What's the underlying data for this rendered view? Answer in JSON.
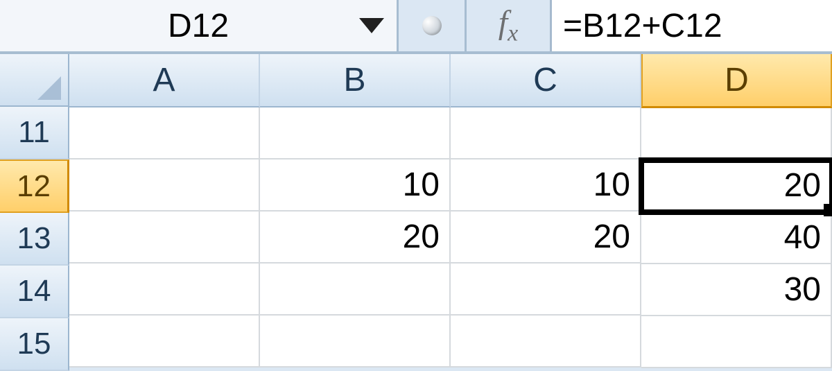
{
  "formula_bar": {
    "name_box": "D12",
    "fx_label": "fx",
    "formula": "=B12+C12"
  },
  "columns": [
    "A",
    "B",
    "C",
    "D"
  ],
  "rows": [
    "11",
    "12",
    "13",
    "14",
    "15"
  ],
  "selected_cell": "D12",
  "cells": {
    "A": {
      "11": "",
      "12": "",
      "13": "",
      "14": "",
      "15": ""
    },
    "B": {
      "11": "",
      "12": "10",
      "13": "20",
      "14": "",
      "15": ""
    },
    "C": {
      "11": "",
      "12": "10",
      "13": "20",
      "14": "",
      "15": ""
    },
    "D": {
      "11": "",
      "12": "20",
      "13": "40",
      "14": "30",
      "15": ""
    }
  }
}
